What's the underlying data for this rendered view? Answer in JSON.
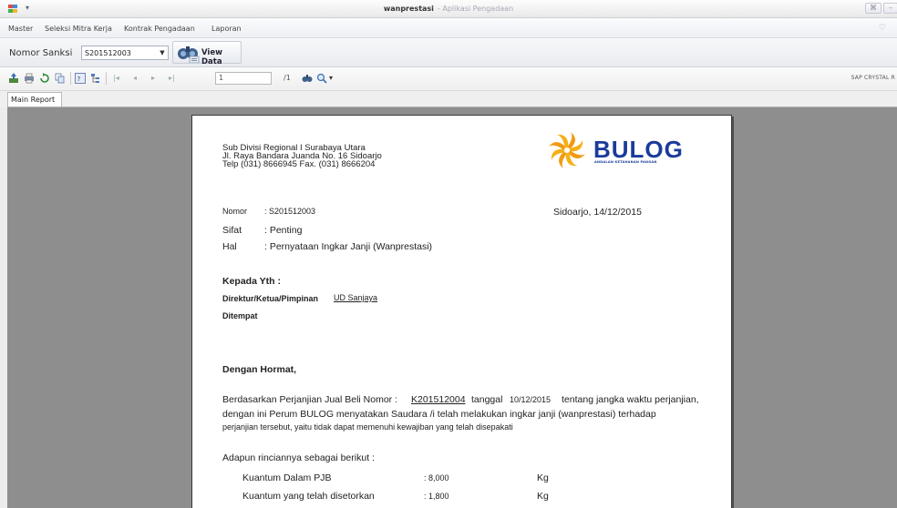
{
  "window": {
    "document_title": "wanprestasi",
    "app_title": "- Aplikasi Pengadaan",
    "buttons": [
      "Ribbon",
      "Minimize"
    ]
  },
  "menu": {
    "items": [
      "Master",
      "Seleksi Mitra Kerja",
      "Kontrak Pengadaan",
      "Laporan"
    ],
    "collapse_glyph": "♡"
  },
  "filter": {
    "label": "Nomor Sanksi",
    "selected_value": "S201512003",
    "view_button": "View Data"
  },
  "report_toolbar": {
    "page_value": "1",
    "page_total": "/1",
    "brand": "SAP CRYSTAL R",
    "icons": [
      "export-icon",
      "print-icon",
      "refresh-icon",
      "copy-icon",
      "toggle-tree-icon",
      "group-tree-icon",
      "first-page-icon",
      "prev-page-icon",
      "next-page-icon",
      "last-page-icon",
      "find-icon",
      "zoom-icon"
    ]
  },
  "tabs": {
    "active": "Main Report"
  },
  "letter": {
    "header_lines": [
      "Sub Divisi Regional I Surabaya Utara",
      "Jl. Raya Bandara Juanda No. 16 Sidoarjo",
      "Telp (031) 8666945  Fax. (031) 8666204"
    ],
    "logo_word": "BULOG",
    "logo_tagline": "ANDALAN KETAHANAN PANGAN",
    "nomor_label": "Nomor",
    "nomor_value": ": S201512003",
    "sifat_label": "Sifat",
    "sifat_value": ": Penting",
    "hal_label": "Hal",
    "hal_value": ": Pernyataan Ingkar Janji (Wanprestasi)",
    "place_date": "Sidoarjo,  14/12/2015",
    "kepada": "Kepada Yth :",
    "direktur_label": "Direktur/Ketua/Pimpinan",
    "recipient": "UD Sanjaya",
    "ditempat": "Ditempat",
    "salutation": "Dengan Hormat,",
    "body_1a": "Berdasarkan Perjanjian Jual Beli Nomor :",
    "contract_no": "K201512004",
    "body_1b": "tanggal",
    "contract_date": "10/12/2015",
    "body_1c": "tentang jangka waktu perjanjian,",
    "body_2": "dengan ini Perum BULOG menyatakan Saudara /i telah melakukan ingkar janji  (wanprestasi) terhadap",
    "body_3": "perjanjian tersebut, yaitu tidak dapat memenuhi kewajiban yang telah disepakati",
    "rincian_intro": "Adapun rinciannya sebagai berikut  :",
    "rows": [
      {
        "label": "Kuantum Dalam PJB",
        "value": ": 8,000",
        "unit": "Kg"
      },
      {
        "label": "Kuantum yang telah disetorkan",
        "value": ": 1,800",
        "unit": "Kg"
      }
    ]
  }
}
